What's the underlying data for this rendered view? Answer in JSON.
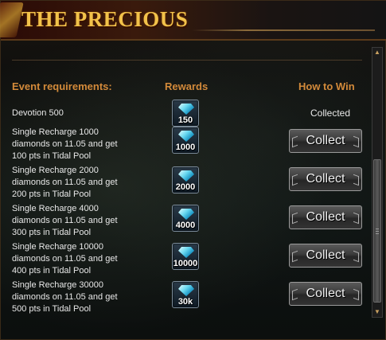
{
  "header": {
    "title": "THE PRECIOUS"
  },
  "columns": {
    "requirements": "Event requirements:",
    "rewards": "Rewards",
    "how_to_win": "How to Win"
  },
  "rows": [
    {
      "requirement": "Devotion 500",
      "reward_amount": "150",
      "status": "Collected"
    },
    {
      "requirement": "Single Recharge 1000 diamonds on 11.05 and get 100 pts in Tidal Pool",
      "reward_amount": "1000",
      "action": "Collect"
    },
    {
      "requirement": "Single Recharge 2000 diamonds on 11.05 and get 200 pts in Tidal Pool",
      "reward_amount": "2000",
      "action": "Collect"
    },
    {
      "requirement": "Single Recharge 4000 diamonds on 11.05 and get 300 pts in Tidal Pool",
      "reward_amount": "4000",
      "action": "Collect"
    },
    {
      "requirement": "Single Recharge 10000 diamonds on 11.05 and get 400 pts in Tidal Pool",
      "reward_amount": "10000",
      "action": "Collect"
    },
    {
      "requirement": "Single Recharge 30000 diamonds on 11.05 and get 500 pts in Tidal Pool",
      "reward_amount": "30k",
      "action": "Collect"
    }
  ],
  "icons": {
    "reward": "diamond-icon",
    "scroll_up": "arrow-up-icon",
    "scroll_down": "arrow-down-icon"
  },
  "colors": {
    "title": "#f2c24a",
    "column_header": "#d38a3a",
    "text": "#e8e8e8"
  }
}
